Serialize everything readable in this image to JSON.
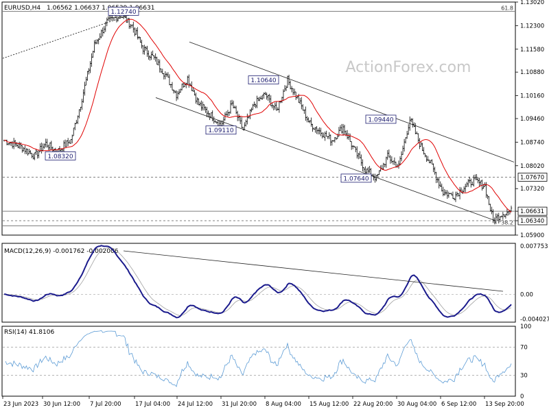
{
  "header": {
    "symbol": "EURUSD,H4",
    "ohlc": "1.06562 1.06637 1.06539 1.06631"
  },
  "watermark": "ActionForex.com",
  "colors": {
    "background": "#ffffff",
    "frame": "#000000",
    "candle": "#000000",
    "ma": "#e00000",
    "macd_line": "#1a1a8c",
    "macd_signal": "#a0a0a0",
    "rsi_line": "#5b9bd5",
    "label_box": "#1a1a6e",
    "watermark": "#c8c8c8"
  },
  "chart_data": [
    {
      "type": "candlestick",
      "panel": "price",
      "y_ticks": [
        "1.13020",
        "1.12300",
        "1.11580",
        "1.10880",
        "1.10160",
        "1.09460",
        "1.08740",
        "1.08020",
        "1.07320",
        "1.06631",
        "1.06340",
        "1.05900"
      ],
      "ylim": [
        1.059,
        1.1302
      ],
      "x_ticks": [
        "23 Jun 2023",
        "30 Jun 12:00",
        "7 Jul 20:00",
        "17 Jul 04:00",
        "24 Jul 12:00",
        "31 Jul 20:00",
        "8 Aug 04:00",
        "15 Aug 12:00",
        "22 Aug 20:00",
        "30 Aug 04:00",
        "6 Sep 12:00",
        "13 Sep 20:00"
      ],
      "current_price": "1.06631",
      "level_labels": [
        {
          "label": "1.12740",
          "price": 1.1274
        },
        {
          "label": "1.10640",
          "price": 1.1064
        },
        {
          "label": "1.09440",
          "price": 1.0944
        },
        {
          "label": "1.09110",
          "price": 1.0911
        },
        {
          "label": "1.08320",
          "price": 1.0832
        },
        {
          "label": "1.07640",
          "price": 1.0764
        }
      ],
      "horizontal_lines": [
        {
          "price": 1.1274,
          "style": "solid",
          "text": "61.8"
        },
        {
          "price": 1.0767,
          "style": "dashed",
          "label": "1.07670"
        },
        {
          "price": 1.0663,
          "style": "solid",
          "label": "1.06631"
        },
        {
          "price": 1.0634,
          "style": "dashed",
          "label": "1.06340"
        },
        {
          "price": 1.0618,
          "style": "solid",
          "text": "38.2"
        }
      ]
    },
    {
      "type": "line",
      "panel": "macd",
      "title": "MACD(12,26,9) -0.001762 -0.002006",
      "y_ticks": [
        "0.007753",
        "0.00",
        "-0.004027"
      ],
      "ylim": [
        -0.0045,
        0.0082
      ]
    },
    {
      "type": "line",
      "panel": "rsi",
      "title": "RSI(14) 41.8106",
      "y_ticks": [
        "100",
        "70",
        "30",
        "0"
      ],
      "ylim": [
        0,
        100
      ],
      "levels": [
        70,
        30
      ]
    }
  ]
}
